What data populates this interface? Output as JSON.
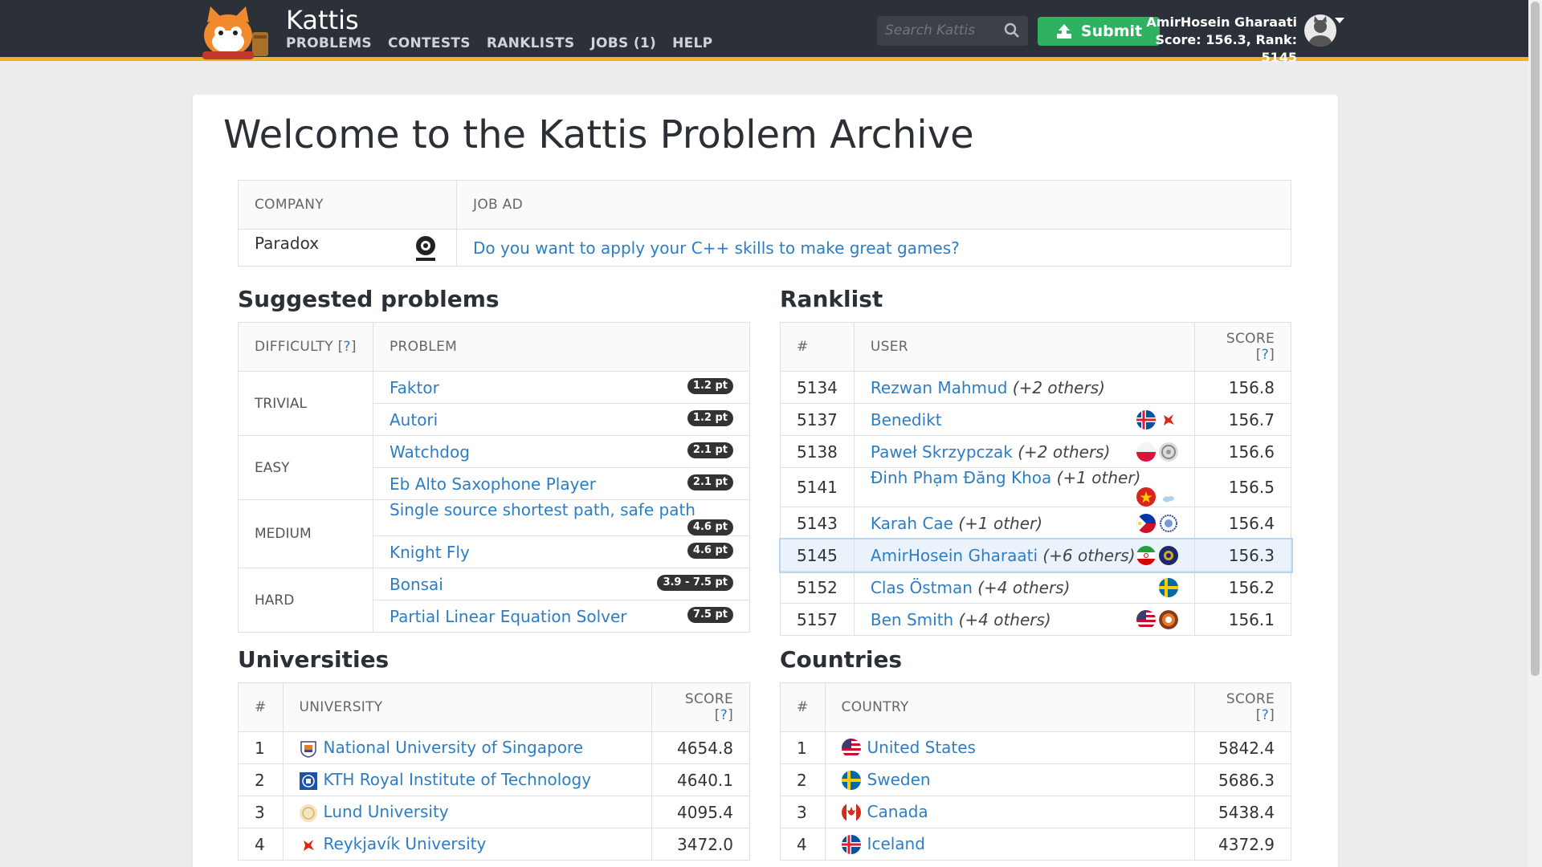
{
  "header": {
    "brand": "Kattis",
    "nav": [
      "PROBLEMS",
      "CONTESTS",
      "RANKLISTS",
      "JOBS (1)",
      "HELP"
    ],
    "search_placeholder": "Search Kattis",
    "submit_label": "Submit",
    "user_name": "AmirHosein Gharaati",
    "user_stats": "Score: 156.3, Rank: 5145"
  },
  "page": {
    "title": "Welcome to the Kattis Problem Archive"
  },
  "jobs": {
    "col_company": "COMPANY",
    "col_ad": "JOB AD",
    "company": "Paradox",
    "ad": "Do you want to apply your C++ skills to make great games?"
  },
  "suggested": {
    "heading": "Suggested problems",
    "col_difficulty": "DIFFICULTY",
    "help": "?",
    "col_problem": "PROBLEM",
    "groups": [
      {
        "level": "TRIVIAL",
        "problems": [
          {
            "name": "Faktor",
            "pts": "1.2 pt"
          },
          {
            "name": "Autori",
            "pts": "1.2 pt"
          }
        ]
      },
      {
        "level": "EASY",
        "problems": [
          {
            "name": "Watchdog",
            "pts": "2.1 pt"
          },
          {
            "name": "Eb Alto Saxophone Player",
            "pts": "2.1 pt"
          }
        ]
      },
      {
        "level": "MEDIUM",
        "problems": [
          {
            "name": "Single source shortest path, safe path",
            "pts": "4.6 pt"
          },
          {
            "name": "Knight Fly",
            "pts": "4.6 pt"
          }
        ]
      },
      {
        "level": "HARD",
        "problems": [
          {
            "name": "Bonsai",
            "pts": "3.9 - 7.5 pt"
          },
          {
            "name": "Partial Linear Equation Solver",
            "pts": "7.5 pt"
          }
        ]
      }
    ]
  },
  "ranklist": {
    "heading": "Ranklist",
    "col_rank": "#",
    "col_user": "USER",
    "col_score": "SCORE",
    "help": "?",
    "rows": [
      {
        "rank": "5134",
        "user": "Rezwan Mahmud",
        "others": "(+2 others)",
        "score": "156.8",
        "flags": []
      },
      {
        "rank": "5137",
        "user": "Benedikt",
        "others": "",
        "score": "156.7",
        "flags": [
          "iceland",
          "reykjavik"
        ]
      },
      {
        "rank": "5138",
        "user": "Paweł Skrzypczak",
        "others": "(+2 others)",
        "score": "156.6",
        "flags": [
          "poland",
          "uni-seal"
        ]
      },
      {
        "rank": "5141",
        "user": "Đinh Phạm Đăng Khoa",
        "others": "(+1 other)",
        "score": "156.5",
        "flags": [
          "vietnam",
          "cloud"
        ]
      },
      {
        "rank": "5143",
        "user": "Karah Cae",
        "others": "(+1 other)",
        "score": "156.4",
        "flags": [
          "philippines",
          "uni-seal-blue"
        ]
      },
      {
        "rank": "5145",
        "user": "AmirHosein Gharaati",
        "others": "(+6 others)",
        "score": "156.3",
        "flags": [
          "iran",
          "uni-square"
        ],
        "highlight": true
      },
      {
        "rank": "5152",
        "user": "Clas Östman",
        "others": "(+4 others)",
        "score": "156.2",
        "flags": [
          "sweden"
        ]
      },
      {
        "rank": "5157",
        "user": "Ben Smith",
        "others": "(+4 others)",
        "score": "156.1",
        "flags": [
          "usa",
          "uni-orange"
        ]
      }
    ]
  },
  "universities": {
    "heading": "Universities",
    "col_rank": "#",
    "col_name": "UNIVERSITY",
    "col_score": "SCORE",
    "help": "?",
    "rows": [
      {
        "rank": "1",
        "name": "National University of Singapore",
        "score": "4654.8",
        "logo": "nus"
      },
      {
        "rank": "2",
        "name": "KTH Royal Institute of Technology",
        "score": "4640.1",
        "logo": "kth"
      },
      {
        "rank": "3",
        "name": "Lund University",
        "score": "4095.4",
        "logo": "lund"
      },
      {
        "rank": "4",
        "name": "Reykjavík University",
        "score": "3472.0",
        "logo": "ru"
      }
    ]
  },
  "countries": {
    "heading": "Countries",
    "col_rank": "#",
    "col_name": "COUNTRY",
    "col_score": "SCORE",
    "help": "?",
    "rows": [
      {
        "rank": "1",
        "name": "United States",
        "score": "5842.4",
        "flag": "usa"
      },
      {
        "rank": "2",
        "name": "Sweden",
        "score": "5686.3",
        "flag": "sweden"
      },
      {
        "rank": "3",
        "name": "Canada",
        "score": "5438.4",
        "flag": "canada"
      },
      {
        "rank": "4",
        "name": "Iceland",
        "score": "4372.9",
        "flag": "iceland"
      }
    ]
  },
  "colors": {
    "accent": "#f2b128",
    "link": "#2d7dc4",
    "submit": "#2eb262",
    "topbar": "#2c3038"
  }
}
